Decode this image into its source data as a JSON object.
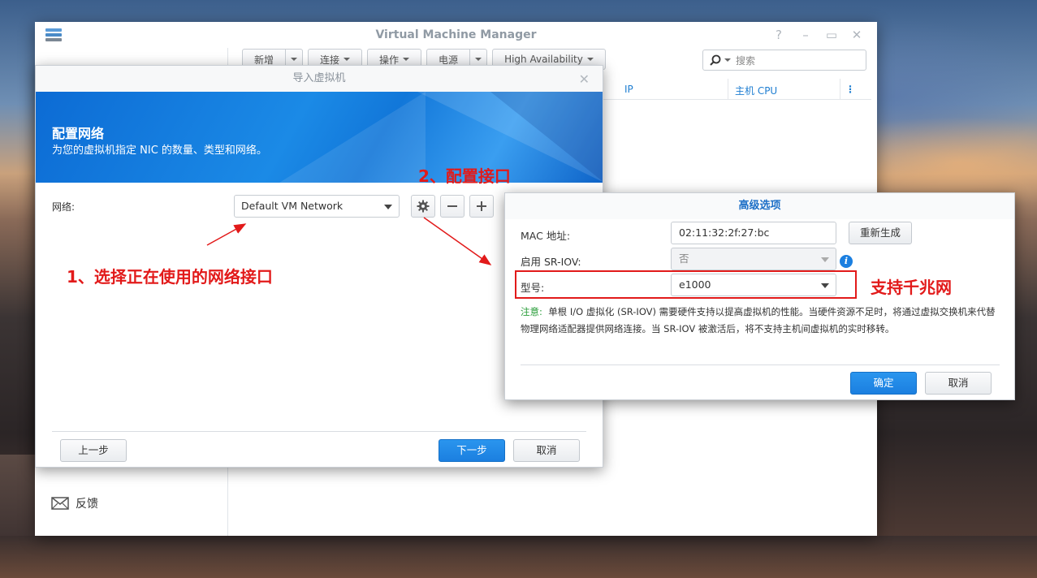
{
  "vmm": {
    "title": "Virtual Machine Manager",
    "toolbar": {
      "new": "新增",
      "connect": "连接",
      "action": "操作",
      "power": "电源",
      "ha": "High Availability"
    },
    "search_placeholder": "搜索",
    "table_headers": [
      "IP",
      "主机 CPU"
    ],
    "sidebar_feedback": "反馈"
  },
  "wizard": {
    "title": "导入虚拟机",
    "heading": "配置网络",
    "subheading": "为您的虚拟机指定 NIC 的数量、类型和网络。",
    "network_label": "网络:",
    "network_value": "Default VM Network",
    "prev_label": "上一步",
    "next_label": "下一步",
    "cancel_label": "取消"
  },
  "advanced": {
    "title": "高级选项",
    "mac_label": "MAC 地址:",
    "mac_value": "02:11:32:2f:27:bc",
    "regenerate_label": "重新生成",
    "sriov_label": "启用 SR-IOV:",
    "sriov_value": "否",
    "model_label": "型号:",
    "model_value": "e1000",
    "note_label": "注意:",
    "note_text": "单根 I/O 虚拟化 (SR-IOV) 需要硬件支持以提高虚拟机的性能。当硬件资源不足时，将通过虚拟交换机来代替物理网络适配器提供网络连接。当 SR-IOV 被激活后，将不支持主机间虚拟机的实时移转。",
    "ok_label": "确定",
    "cancel_label": "取消"
  },
  "annotations": {
    "step1": "1、选择正在使用的网络接口",
    "step2": "2、配置接口",
    "gigabit": "支持千兆网",
    "color": "#e21a1a"
  },
  "colors": {
    "accent": "#1b7fe0",
    "note_green": "#2a9d3a"
  }
}
